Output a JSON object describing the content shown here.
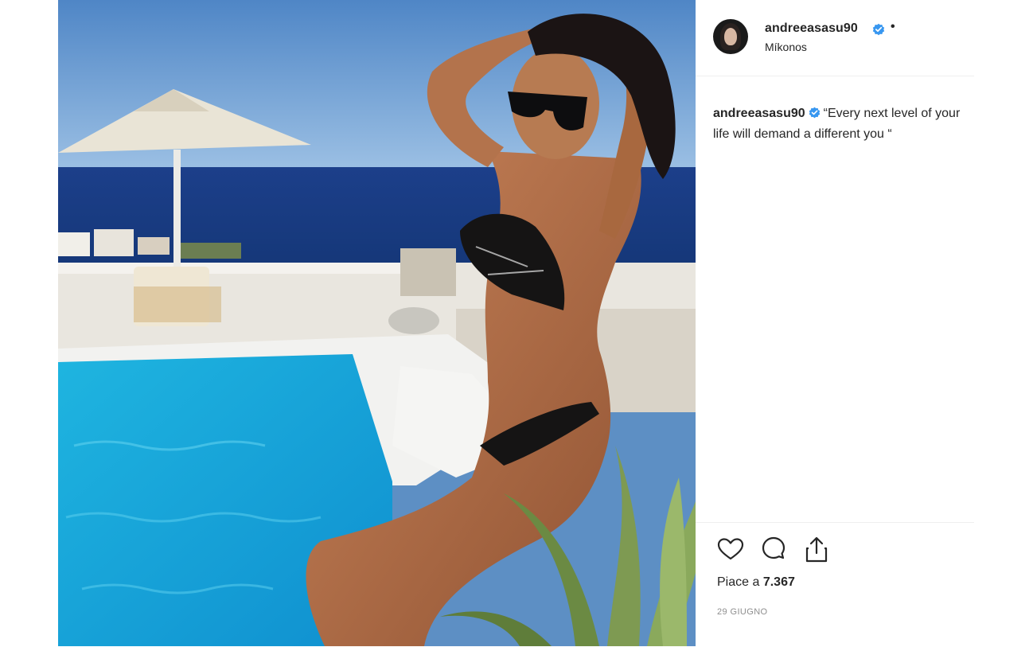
{
  "post": {
    "author": {
      "username": "andreeasasu90",
      "verified": true,
      "location": "Míkonos",
      "separator": "•"
    },
    "caption": {
      "username": "andreeasasu90",
      "text": "“Every next level of your life will demand a different you “"
    },
    "actions": {
      "like_icon": "heart-icon",
      "comment_icon": "comment-icon",
      "share_icon": "share-icon"
    },
    "likes": {
      "label": "Piace a",
      "count": "7.367"
    },
    "date": "29 GIUGNO"
  },
  "colors": {
    "text": "#262626",
    "muted": "#8e8e8e",
    "verified": "#3897f0",
    "border": "#efefef"
  }
}
